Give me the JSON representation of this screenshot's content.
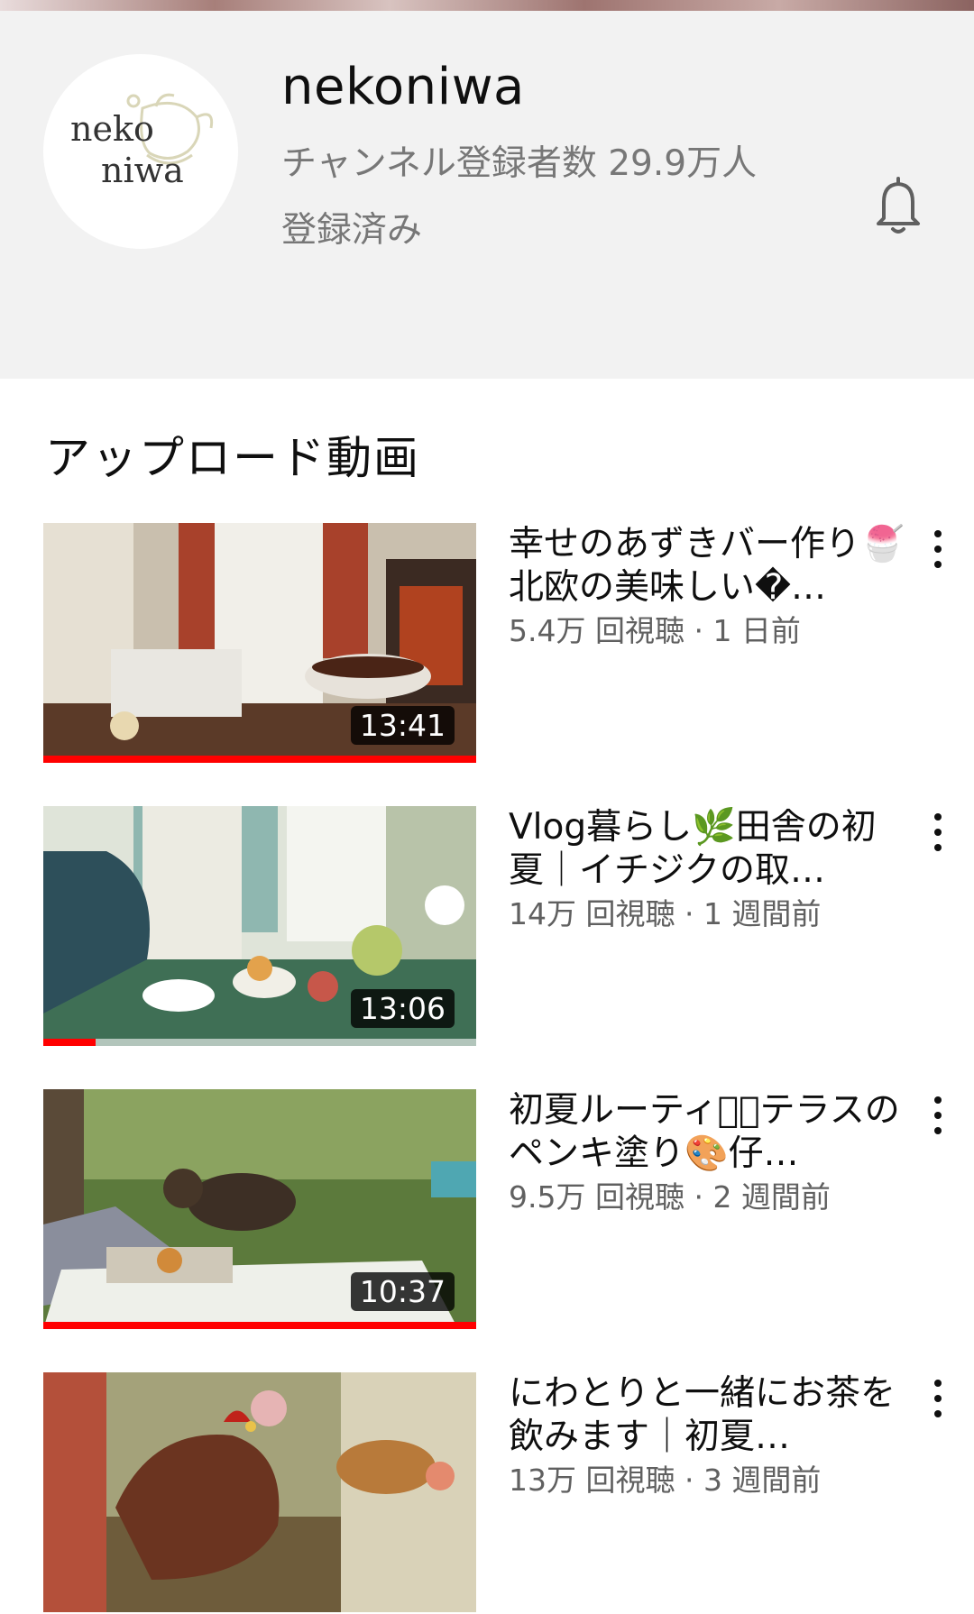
{
  "channel": {
    "name": "nekoniwa",
    "subscribers": "チャンネル登録者数 29.9万人",
    "status": "登録済み",
    "logo_text_line1": "neko",
    "logo_text_line2": "niwa"
  },
  "section": {
    "title": "アップロード動画"
  },
  "videos": [
    {
      "title": "幸せのあずきバー作り🍧北欧の美味しい�…",
      "meta": "5.4万 回視聴 · 1 日前",
      "duration": "13:41",
      "progress": 1.0
    },
    {
      "title": "Vlog暮らし🌿田舎の初夏｜イチジクの取…",
      "meta": "14万 回視聴 · 1 週間前",
      "duration": "13:06",
      "progress": 0.12
    },
    {
      "title": "初夏ルーティン⃒テラスのペンキ塗り🎨仔…",
      "meta": "9.5万 回視聴 · 2 週間前",
      "duration": "10:37",
      "progress": 1.0
    },
    {
      "title": "にわとりと一緒にお茶を飲みます｜初夏…",
      "meta": "13万 回視聴 · 3 週間前",
      "duration": "",
      "progress": 0
    }
  ]
}
